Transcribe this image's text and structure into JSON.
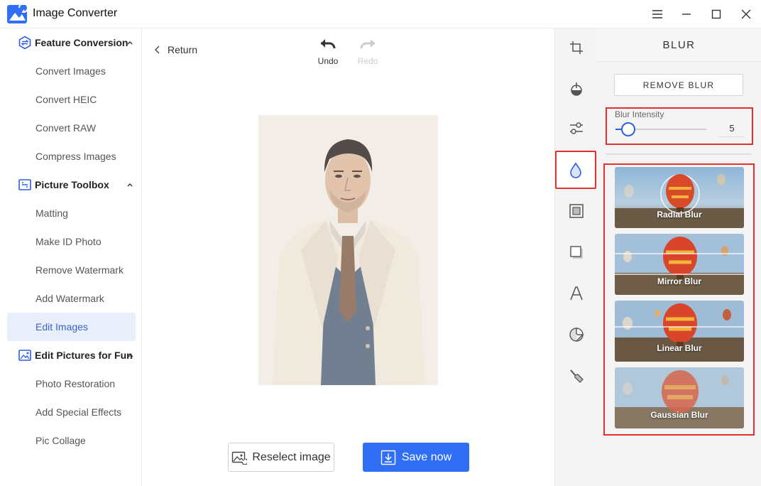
{
  "app": {
    "title": "Image Converter"
  },
  "window_controls": [
    "menu-icon",
    "minimize-icon",
    "maximize-icon",
    "close-icon"
  ],
  "sidebar": {
    "sections": [
      {
        "label": "Feature Conversion",
        "icon": "convert-icon",
        "items": [
          "Convert Images",
          "Convert HEIC",
          "Convert RAW",
          "Compress Images"
        ]
      },
      {
        "label": "Picture Toolbox",
        "icon": "toolbox-icon",
        "items": [
          "Matting",
          "Make ID Photo",
          "Remove Watermark",
          "Add Watermark",
          "Edit Images"
        ]
      },
      {
        "label": "Edit Pictures for Fun",
        "icon": "fun-picture-icon",
        "items": [
          "Photo Restoration",
          "Add Special Effects",
          "Pic Collage"
        ]
      }
    ],
    "active_item": "Edit Images"
  },
  "editor": {
    "return_label": "Return",
    "undo_label": "Undo",
    "redo_label": "Redo",
    "reselect_label": "Reselect image",
    "save_label": "Save now"
  },
  "tools": [
    "crop-icon",
    "adjust-icon",
    "filter-icon",
    "blur-icon",
    "frame-icon",
    "shadow-icon",
    "text-icon",
    "sticker-icon",
    "brush-icon"
  ],
  "active_tool": "blur-icon",
  "blur_panel": {
    "title": "BLUR",
    "remove_label": "REMOVE BLUR",
    "intensity_label": "Blur Intensity",
    "intensity_value": "5",
    "intensity_fraction": 0.12,
    "effects": [
      "Radial Blur",
      "Mirror Blur",
      "Linear Blur",
      "Gaussian Blur"
    ]
  },
  "colors": {
    "accent": "#2f6ef5",
    "highlight_border": "#e03030",
    "active_nav_bg": "#e9eefb"
  }
}
